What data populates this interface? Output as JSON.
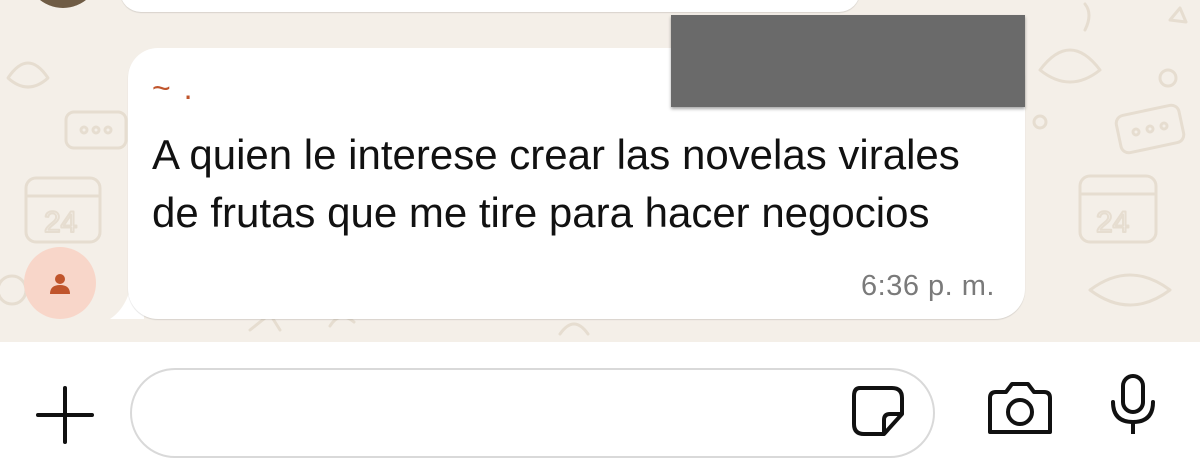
{
  "chat": {
    "message": {
      "sender": "~ .",
      "text": "A quien le interese crear las novelas virales de frutas que me tire para hacer negocios",
      "time": "6:36 p. m."
    }
  },
  "composer": {
    "placeholder": ""
  },
  "icons": {
    "plus": "plus-icon",
    "sticker": "sticker-icon",
    "camera": "camera-icon",
    "mic": "microphone-icon",
    "avatar": "person-icon"
  },
  "colors": {
    "wallpaper": "#f4efe8",
    "sender_name": "#c0552c",
    "avatar_bg": "#f8d6c9",
    "redaction": "#6a6a6a"
  }
}
